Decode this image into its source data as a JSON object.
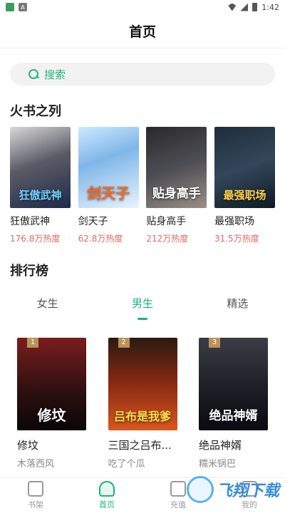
{
  "status_bar": {
    "time": "1:42"
  },
  "header": {
    "title": "首页"
  },
  "search": {
    "label": "搜索"
  },
  "section_hot": {
    "title": "火书之列"
  },
  "hot_books": [
    {
      "title": "狂傲武神",
      "heat": "176.8万热度",
      "cover_text": "狂傲武神"
    },
    {
      "title": "剑天子",
      "heat": "62.8万热度",
      "cover_text": "剑天子"
    },
    {
      "title": "贴身高手",
      "heat": "212万热度",
      "cover_text": "贴身高手"
    },
    {
      "title": "最强职场",
      "heat": "31.5万热度",
      "cover_text": "最强职场"
    }
  ],
  "section_rank": {
    "title": "排行榜"
  },
  "tabs": [
    {
      "label": "女生"
    },
    {
      "label": "男生"
    },
    {
      "label": "精选"
    }
  ],
  "rank_books": [
    {
      "rank": "1",
      "title": "修坟",
      "author": "木落西风",
      "cover_text": "修坟"
    },
    {
      "rank": "2",
      "title": "三国之吕布...",
      "author": "吃了个瓜",
      "cover_text": "吕布是我爹"
    },
    {
      "rank": "3",
      "title": "绝品神婿",
      "author": "糯米锅巴",
      "cover_text": "绝品神婿"
    }
  ],
  "bottom_nav": [
    {
      "label": "书架"
    },
    {
      "label": "首页"
    },
    {
      "label": "充值"
    },
    {
      "label": "我的"
    }
  ],
  "watermark": {
    "text": "飞翔下载"
  },
  "colors": {
    "accent": "#1bb27a",
    "heat": "#e06a5f"
  }
}
